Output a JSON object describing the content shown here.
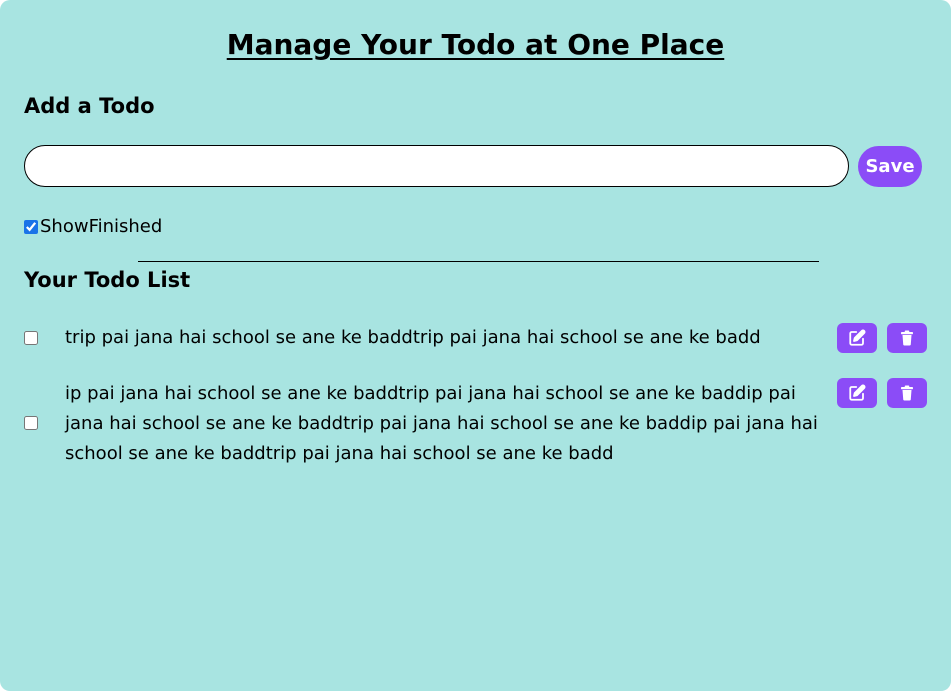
{
  "header": {
    "title": "Manage Your Todo at One Place"
  },
  "add_todo": {
    "heading": "Add a Todo",
    "input_value": "",
    "save_label": "Save"
  },
  "show_finished": {
    "label": "ShowFinished",
    "checked": true
  },
  "todo_list": {
    "heading": "Your Todo List",
    "items": [
      {
        "text": "trip pai jana hai school se ane ke baddtrip pai jana hai school se ane ke badd",
        "completed": false
      },
      {
        "text": "ip pai jana hai school se ane ke baddtrip pai jana hai school se ane ke baddip pai jana hai school se ane ke baddtrip pai jana hai school se ane ke baddip pai jana hai school se ane ke baddtrip pai jana hai school se ane ke badd",
        "completed": false
      }
    ]
  },
  "colors": {
    "background": "#a8e4e1",
    "accent": "#8b4cf7"
  },
  "icons": {
    "edit": "edit-icon",
    "delete": "trash-icon"
  }
}
